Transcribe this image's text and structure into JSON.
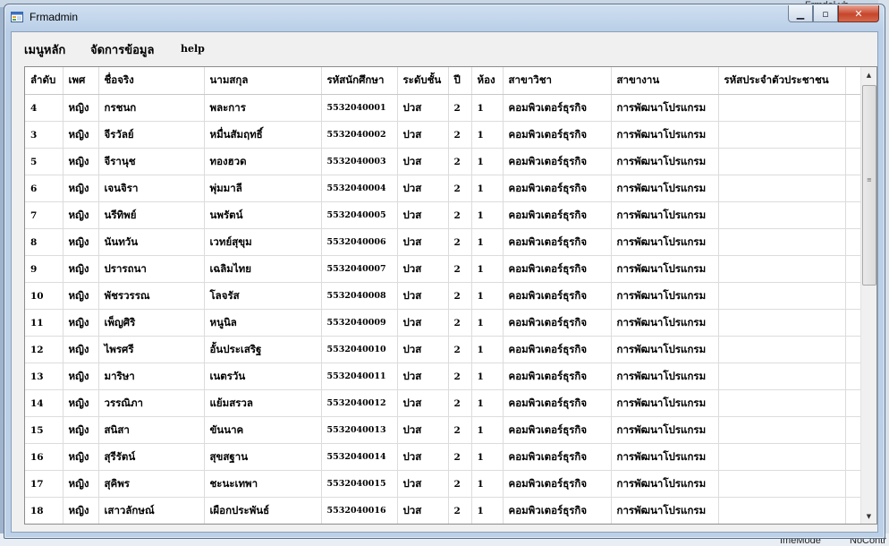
{
  "background": {
    "tab_text": "Frmdel.vb",
    "bottom_texts": [
      "ImeMode",
      "NoContr"
    ]
  },
  "window": {
    "title": "Frmadmin",
    "controls": {
      "minimize": "▁",
      "maximize": "▫",
      "close": "✕"
    }
  },
  "menu": {
    "items": [
      "เมนูหลัก",
      "จัดการข้อมูล",
      "help"
    ]
  },
  "table": {
    "columns": [
      "ลำดับ",
      "เพศ",
      "ชื่อจริง",
      "นามสกุล",
      "รหัสนักศึกษา",
      "ระดับชั้น",
      "ปี",
      "ห้อง",
      "สาขาวิชา",
      "สาขางาน",
      "รหัสประจำตัวประชาชน"
    ],
    "rows": [
      [
        "4",
        "หญิง",
        "กรชนก",
        "พละการ",
        "5532040001",
        "ปวส",
        "2",
        "1",
        "คอมพิวเตอร์ธุรกิจ",
        "การพัฒนาโปรแกรม",
        ""
      ],
      [
        "3",
        "หญิง",
        "จีรวัลย์",
        "หมื่นสัมฤทธิ์",
        "5532040002",
        "ปวส",
        "2",
        "1",
        "คอมพิวเตอร์ธุรกิจ",
        "การพัฒนาโปรแกรม",
        ""
      ],
      [
        "5",
        "หญิง",
        "จีรานุช",
        "ทองฮวด",
        "5532040003",
        "ปวส",
        "2",
        "1",
        "คอมพิวเตอร์ธุรกิจ",
        "การพัฒนาโปรแกรม",
        ""
      ],
      [
        "6",
        "หญิง",
        "เจนจิรา",
        "พุ่มมาลี",
        "5532040004",
        "ปวส",
        "2",
        "1",
        "คอมพิวเตอร์ธุรกิจ",
        "การพัฒนาโปรแกรม",
        ""
      ],
      [
        "7",
        "หญิง",
        "นรีทิพย์",
        "นพรัตน์",
        "5532040005",
        "ปวส",
        "2",
        "1",
        "คอมพิวเตอร์ธุรกิจ",
        "การพัฒนาโปรแกรม",
        ""
      ],
      [
        "8",
        "หญิง",
        "นันทวัน",
        "เวทย์สุขุม",
        "5532040006",
        "ปวส",
        "2",
        "1",
        "คอมพิวเตอร์ธุรกิจ",
        "การพัฒนาโปรแกรม",
        ""
      ],
      [
        "9",
        "หญิง",
        "ปรารถนา",
        "เฉลิมไทย",
        "5532040007",
        "ปวส",
        "2",
        "1",
        "คอมพิวเตอร์ธุรกิจ",
        "การพัฒนาโปรแกรม",
        ""
      ],
      [
        "10",
        "หญิง",
        "พัชรวรรณ",
        "โลจรัส",
        "5532040008",
        "ปวส",
        "2",
        "1",
        "คอมพิวเตอร์ธุรกิจ",
        "การพัฒนาโปรแกรม",
        ""
      ],
      [
        "11",
        "หญิง",
        "เพ็ญศิริ",
        "หนูนิล",
        "5532040009",
        "ปวส",
        "2",
        "1",
        "คอมพิวเตอร์ธุรกิจ",
        "การพัฒนาโปรแกรม",
        ""
      ],
      [
        "12",
        "หญิง",
        "ไพรศรี",
        "อั้นประเสริฐ",
        "5532040010",
        "ปวส",
        "2",
        "1",
        "คอมพิวเตอร์ธุรกิจ",
        "การพัฒนาโปรแกรม",
        ""
      ],
      [
        "13",
        "หญิง",
        "มาริษา",
        "เนตรวัน",
        "5532040011",
        "ปวส",
        "2",
        "1",
        "คอมพิวเตอร์ธุรกิจ",
        "การพัฒนาโปรแกรม",
        ""
      ],
      [
        "14",
        "หญิง",
        "วรรณิภา",
        "แย้มสรวล",
        "5532040012",
        "ปวส",
        "2",
        "1",
        "คอมพิวเตอร์ธุรกิจ",
        "การพัฒนาโปรแกรม",
        ""
      ],
      [
        "15",
        "หญิง",
        "สนิสา",
        "ขันนาค",
        "5532040013",
        "ปวส",
        "2",
        "1",
        "คอมพิวเตอร์ธุรกิจ",
        "การพัฒนาโปรแกรม",
        ""
      ],
      [
        "16",
        "หญิง",
        "สุรีรัตน์",
        "สุขสฐาน",
        "5532040014",
        "ปวส",
        "2",
        "1",
        "คอมพิวเตอร์ธุรกิจ",
        "การพัฒนาโปรแกรม",
        ""
      ],
      [
        "17",
        "หญิง",
        "สุคิพร",
        "ชะนะเทพา",
        "5532040015",
        "ปวส",
        "2",
        "1",
        "คอมพิวเตอร์ธุรกิจ",
        "การพัฒนาโปรแกรม",
        ""
      ],
      [
        "18",
        "หญิง",
        "เสาวลักษณ์",
        "เผือกประพันธ์",
        "5532040016",
        "ปวส",
        "2",
        "1",
        "คอมพิวเตอร์ธุรกิจ",
        "การพัฒนาโปรแกรม",
        ""
      ]
    ]
  },
  "scrollbar": {
    "up_icon": "▲",
    "down_icon": "▼",
    "grip_icon": "≡"
  }
}
